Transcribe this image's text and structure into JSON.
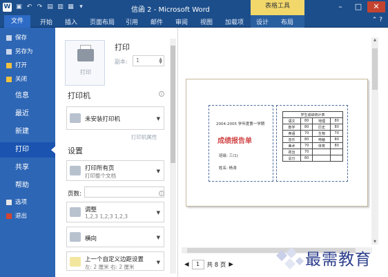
{
  "window": {
    "title": "信函 2 - Microsoft Word",
    "context_tab": "表格工具",
    "app_icon": "W"
  },
  "ribbon": {
    "file_tab": "文件",
    "tabs": [
      "开始",
      "插入",
      "页面布局",
      "引用",
      "邮件",
      "审阅",
      "视图",
      "加载项",
      "设计",
      "布局"
    ]
  },
  "nav": {
    "save": "保存",
    "save_as": "另存为",
    "open": "打开",
    "close": "关闭",
    "info": "信息",
    "recent": "最近",
    "new": "新建",
    "print": "打印",
    "share": "共享",
    "help": "帮助",
    "options": "选项",
    "exit": "退出"
  },
  "print_panel": {
    "heading": "打印",
    "print_button_label": "打印",
    "copies_label": "副本:",
    "copies_value": "1",
    "printer_heading": "打印机",
    "printer_value": "未安装打印机",
    "printer_properties": "打印机属性",
    "settings_heading": "设置",
    "print_all_main": "打印所有页",
    "print_all_sub": "打印整个文档",
    "pages_label": "页数:",
    "collate_main": "调整",
    "collate_sub": "1,2,3    1,2,3    1,2,3",
    "orientation_main": "横向",
    "margins_main": "上一个自定义边距设置",
    "margins_sub": "左: 2 厘米    右: 2 厘米"
  },
  "preview": {
    "year_line": "2004-2005 学年度第一学期",
    "report_title": "成绩报告单",
    "class_line": "班级: 三(1)",
    "name_line": "姓名: 杨涛",
    "table_header": "学生成绩统计表",
    "table_rows": [
      [
        "语文",
        "80",
        "地理",
        "80"
      ],
      [
        "数学",
        "80",
        "历史",
        "80"
      ],
      [
        "英语",
        "70",
        "生物",
        "70"
      ],
      [
        "音乐",
        "80",
        "电脑",
        "80"
      ],
      [
        "美术",
        "70",
        "体育",
        "80"
      ],
      [
        "政治",
        "70",
        "",
        ""
      ],
      [
        "总分",
        "80",
        "",
        ""
      ]
    ],
    "page_current": "1",
    "page_total": "共 8 页"
  },
  "watermark": {
    "text": "最需教育"
  },
  "colors": {
    "titlebar": "#1c4e8b",
    "nav": "#2d66b5",
    "context": "#f2d86b",
    "report_title": "#d14747"
  }
}
